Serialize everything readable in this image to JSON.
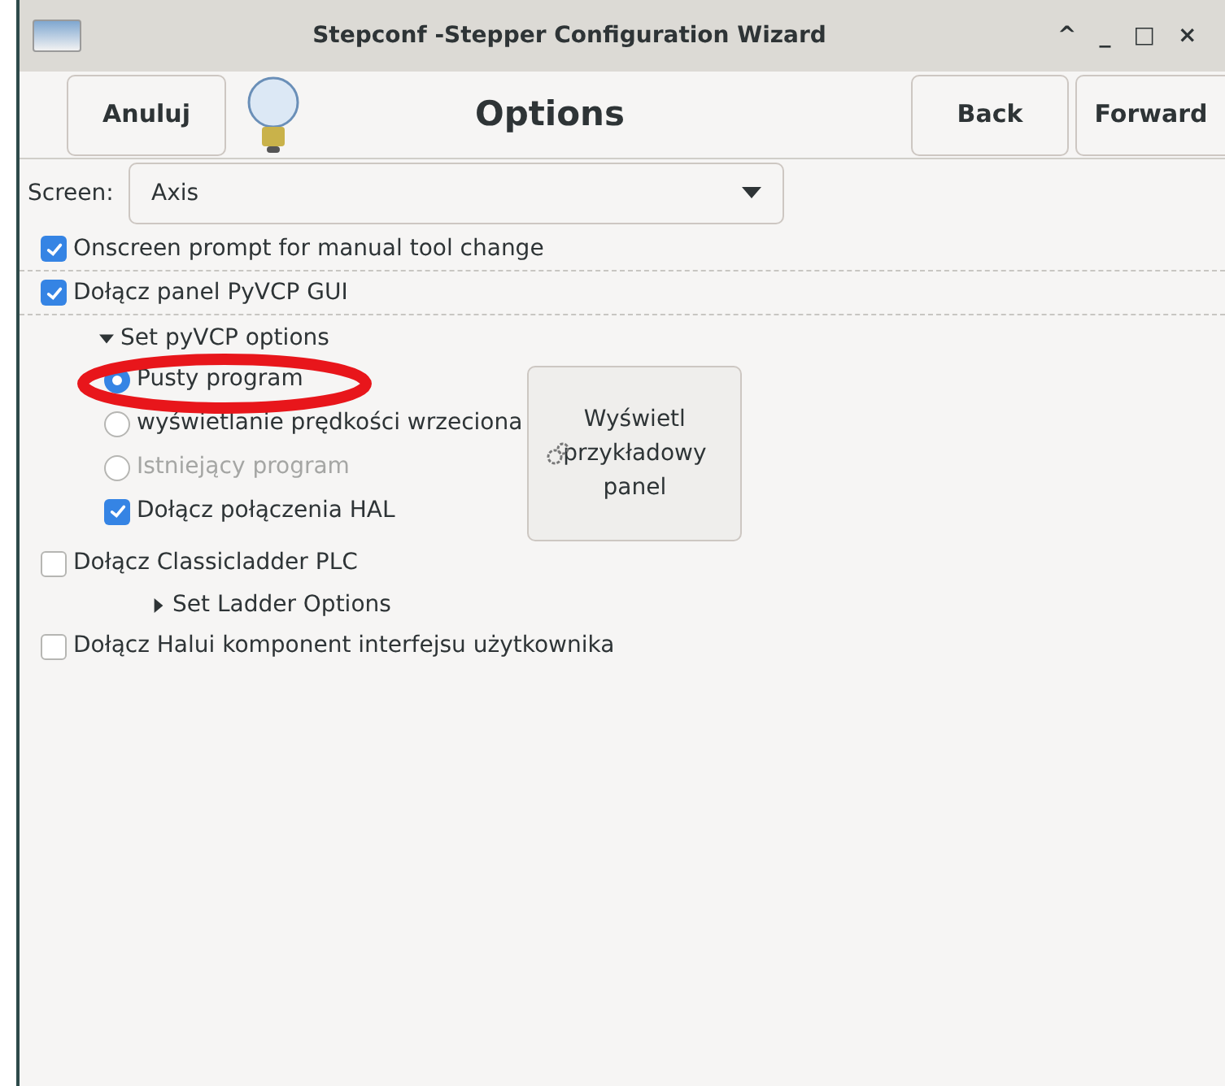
{
  "window": {
    "title": "Stepconf -Stepper Configuration Wizard",
    "controls": [
      "^",
      "_",
      "□",
      "×"
    ]
  },
  "header": {
    "cancel": "Anuluj",
    "title": "Options",
    "back": "Back",
    "forward": "Forward"
  },
  "screen": {
    "label": "Screen:",
    "value": "Axis"
  },
  "options": [
    {
      "label": "Onscreen prompt for manual tool change",
      "checked": true
    },
    {
      "label": "Dołącz panel PyVCP GUI",
      "checked": true
    }
  ],
  "pyvcp": {
    "label": "Set pyVCP options",
    "expanded": true,
    "radios": [
      {
        "label": "Pusty program",
        "selected": true,
        "disabled": false
      },
      {
        "label": "wyświetlanie prędkości wrzeciona",
        "selected": false,
        "disabled": false
      },
      {
        "label": "Istniejący program",
        "selected": false,
        "disabled": true
      }
    ],
    "hal": {
      "label": "Dołącz połączenia HAL",
      "checked": true
    },
    "preview_button": "Wyświetl przykładowy panel"
  },
  "classicladder": {
    "label": "Dołącz Classicladder PLC",
    "checked": false
  },
  "ladder": {
    "label": "Set Ladder Options",
    "expanded": false
  },
  "halui": {
    "label": "Dołącz Halui komponent interfejsu użytkownika",
    "checked": false
  }
}
